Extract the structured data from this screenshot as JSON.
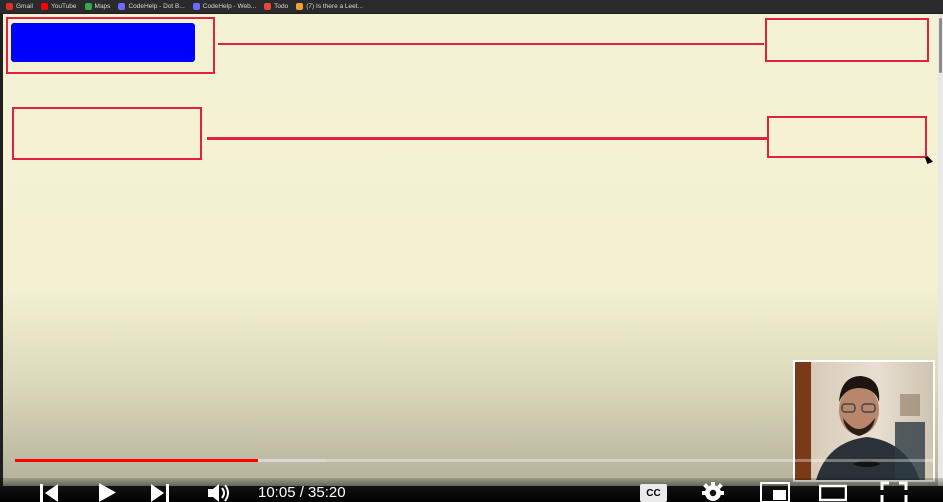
{
  "bookmarks": [
    {
      "label": "Gmail",
      "icon": "gmail-icon",
      "color": "#d93025"
    },
    {
      "label": "YouTube",
      "icon": "youtube-icon",
      "color": "#ff0000"
    },
    {
      "label": "Maps",
      "icon": "maps-icon",
      "color": "#34a853"
    },
    {
      "label": "CodeHelp - Dot B...",
      "icon": "codehelp-icon",
      "color": "#6b6bff"
    },
    {
      "label": "CodeHelp - Web...",
      "icon": "codehelp-icon",
      "color": "#6b6bff"
    },
    {
      "label": "Todo",
      "icon": "todo-icon",
      "color": "#e8453c"
    },
    {
      "label": "(7) Is there a Leet...",
      "icon": "leetcode-icon",
      "color": "#f0a030"
    }
  ],
  "player": {
    "time": "10:05 / 35:20",
    "cc_label": "CC",
    "progress": 0.265,
    "buffered": 0.34
  },
  "colors": {
    "page_bg": "#f4f2d4",
    "outline": "#e4213c",
    "block": "#0000ff",
    "progress": "#ff0000"
  }
}
